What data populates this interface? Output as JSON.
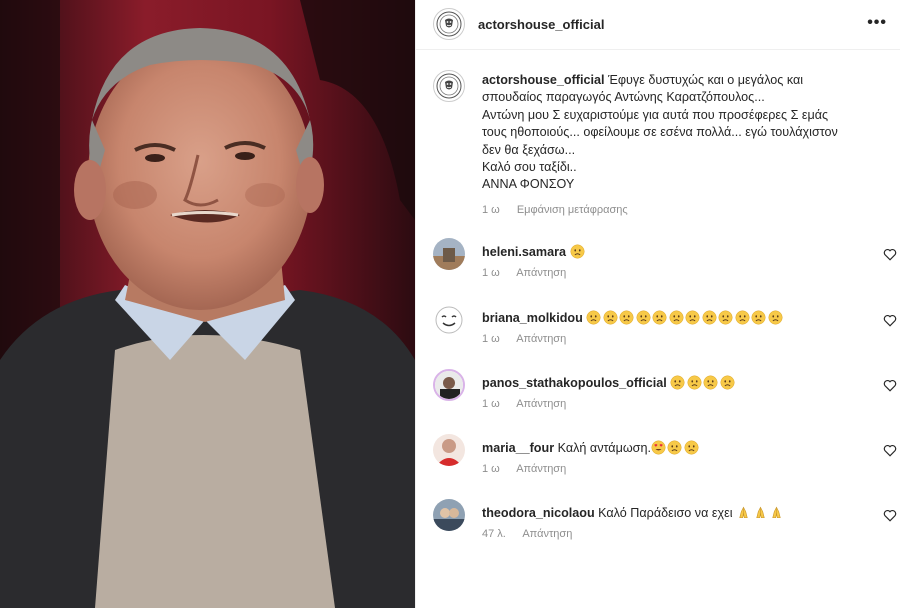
{
  "post": {
    "username": "actorshouse_official",
    "more_label": "•••"
  },
  "caption": {
    "username": "actorshouse_official",
    "lines": [
      "Έφυγε δυστυχώς και ο μεγάλος και",
      "σπουδαίος παραγωγός Αντώνης Καρατζόπουλος...",
      "Αντώνη μου Σ ευχαριστούμε για αυτά που προσέφερες Σ εμάς",
      "τους ηθοποιούς... οφείλουμε σε εσένα πολλά... εγώ τουλάχιστον",
      "δεν θα ξεχάσω...",
      "Καλό σου ταξίδι..",
      "ΑΝΝΑ ΦΟΝΣΟΥ"
    ],
    "time": "1 ω",
    "translate_label": "Εμφάνιση μετάφρασης"
  },
  "comments": [
    {
      "username": "heleni.samara",
      "text": "",
      "emojis": [
        "sad"
      ],
      "time": "1 ω",
      "reply_label": "Απάντηση"
    },
    {
      "username": "briana_molkidou",
      "text": "",
      "emojis": [
        "sad",
        "sad",
        "sad",
        "sad",
        "sad",
        "sad",
        "sad",
        "sad",
        "sad",
        "sad",
        "sad",
        "sad"
      ],
      "time": "1 ω",
      "reply_label": "Απάντηση"
    },
    {
      "username": "panos_stathakopoulos_official",
      "text": "",
      "emojis": [
        "sad",
        "sad",
        "sad",
        "sad"
      ],
      "time": "1 ω",
      "reply_label": "Απάντηση"
    },
    {
      "username": "maria__four",
      "text": "Καλή αντάμωση.",
      "emojis": [
        "hearteyes",
        "sad",
        "sad"
      ],
      "time": "1 ω",
      "reply_label": "Απάντηση"
    },
    {
      "username": "theodora_nicolaou",
      "text": "Καλό Παράδεισο να εχει",
      "emojis": [
        "pray",
        "pray",
        "pray"
      ],
      "time": "47 λ.",
      "reply_label": "Απάντηση"
    }
  ],
  "colors": {
    "text": "#262626",
    "secondary": "#8e8e8e",
    "border": "#efefef",
    "emoji_face": "#f7c948"
  }
}
